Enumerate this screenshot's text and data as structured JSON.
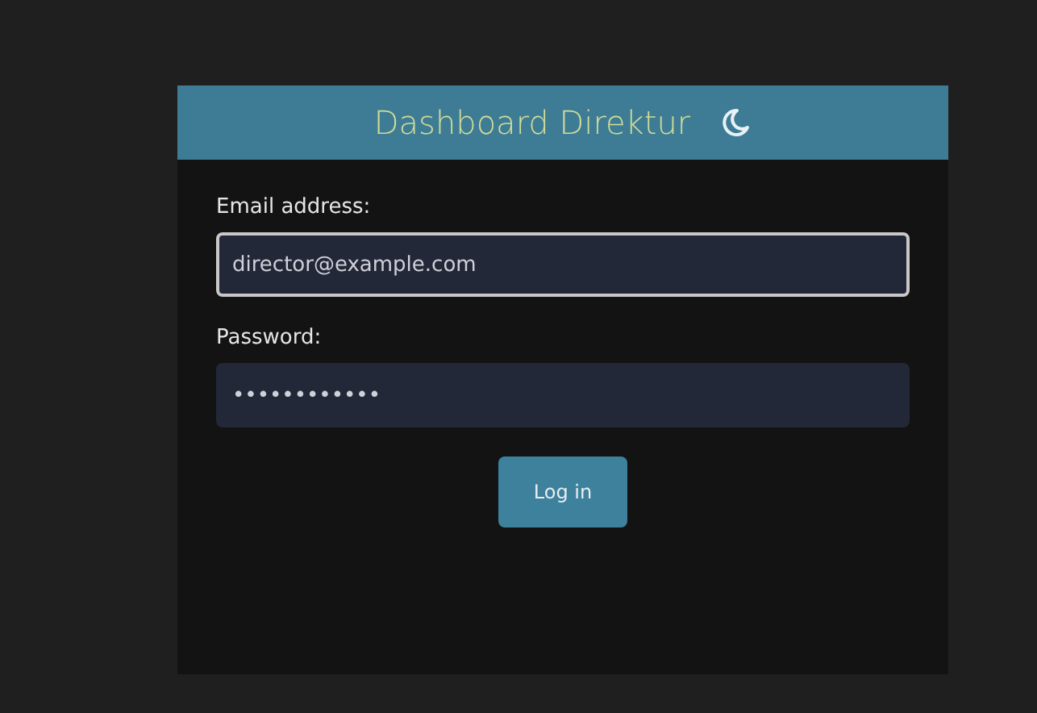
{
  "header": {
    "title": "Dashboard Direktur"
  },
  "fields": [
    {
      "label": "Email address:",
      "value": "director@example.com",
      "focused": true
    },
    {
      "label": "Password:",
      "value": "••••••••••••",
      "focused": false
    }
  ],
  "button": "Log in"
}
